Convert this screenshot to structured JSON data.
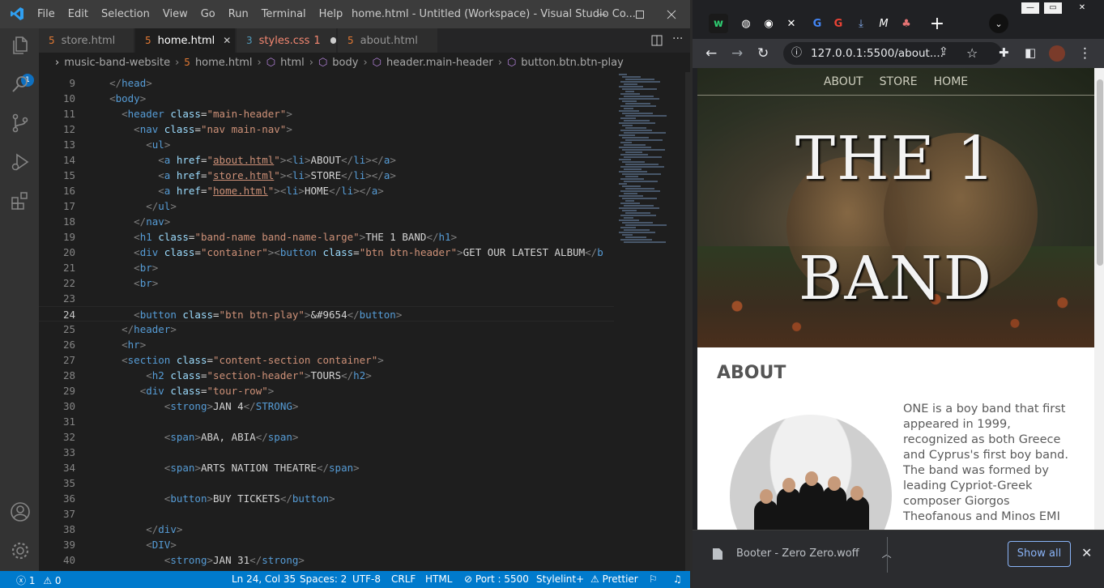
{
  "vscode": {
    "window_title": "home.html - Untitled (Workspace) - Visual Studio Co...",
    "menu": [
      "File",
      "Edit",
      "Selection",
      "View",
      "Go",
      "Run",
      "Terminal",
      "Help"
    ],
    "explorer_badge": "1",
    "tabs": [
      {
        "label": "store.html",
        "type": "html",
        "active": false
      },
      {
        "label": "home.html",
        "type": "html",
        "active": true
      },
      {
        "label": "styles.css",
        "type": "css",
        "active": false,
        "problems": "1",
        "modified": true
      },
      {
        "label": "about.html",
        "type": "html",
        "active": false
      }
    ],
    "breadcrumb": [
      "music-band-website",
      "home.html",
      "html",
      "body",
      "header.main-header",
      "button.btn.btn-play"
    ],
    "code_lines": [
      {
        "n": "9",
        "html": "  <span class='p'>&lt;/</span><span class='t'>head</span><span class='p'>&gt;</span>"
      },
      {
        "n": "10",
        "html": "  <span class='p'>&lt;</span><span class='t'>body</span><span class='p'>&gt;</span>"
      },
      {
        "n": "11",
        "html": "    <span class='p'>&lt;</span><span class='t'>header</span> <span class='a'>class</span>=<span class='s'>\"main-header\"</span><span class='p'>&gt;</span>"
      },
      {
        "n": "12",
        "html": "      <span class='p'>&lt;</span><span class='t'>nav</span> <span class='a'>class</span>=<span class='s'>\"nav main-nav\"</span><span class='p'>&gt;</span>"
      },
      {
        "n": "13",
        "html": "        <span class='p'>&lt;</span><span class='t'>ul</span><span class='p'>&gt;</span>"
      },
      {
        "n": "14",
        "html": "          <span class='p'>&lt;</span><span class='t'>a</span> <span class='a'>href</span>=<span class='s'>\"<span class='u'>about.html</span>\"</span><span class='p'>&gt;&lt;</span><span class='t'>li</span><span class='p'>&gt;</span>ABOUT<span class='p'>&lt;/</span><span class='t'>li</span><span class='p'>&gt;&lt;/</span><span class='t'>a</span><span class='p'>&gt;</span>"
      },
      {
        "n": "15",
        "html": "          <span class='p'>&lt;</span><span class='t'>a</span> <span class='a'>href</span>=<span class='s'>\"<span class='u'>store.html</span>\"</span><span class='p'>&gt;&lt;</span><span class='t'>li</span><span class='p'>&gt;</span>STORE<span class='p'>&lt;/</span><span class='t'>li</span><span class='p'>&gt;&lt;/</span><span class='t'>a</span><span class='p'>&gt;</span>"
      },
      {
        "n": "16",
        "html": "          <span class='p'>&lt;</span><span class='t'>a</span> <span class='a'>href</span>=<span class='s'>\"<span class='u'>home.html</span>\"</span><span class='p'>&gt;&lt;</span><span class='t'>li</span><span class='p'>&gt;</span>HOME<span class='p'>&lt;/</span><span class='t'>li</span><span class='p'>&gt;&lt;/</span><span class='t'>a</span><span class='p'>&gt;</span>"
      },
      {
        "n": "17",
        "html": "        <span class='p'>&lt;/</span><span class='t'>ul</span><span class='p'>&gt;</span>"
      },
      {
        "n": "18",
        "html": "      <span class='p'>&lt;/</span><span class='t'>nav</span><span class='p'>&gt;</span>"
      },
      {
        "n": "19",
        "html": "      <span class='p'>&lt;</span><span class='t'>h1</span> <span class='a'>class</span>=<span class='s'>\"band-name band-name-large\"</span><span class='p'>&gt;</span>THE 1 BAND<span class='p'>&lt;/</span><span class='t'>h1</span><span class='p'>&gt;</span>"
      },
      {
        "n": "20",
        "html": "      <span class='p'>&lt;</span><span class='t'>div</span> <span class='a'>class</span>=<span class='s'>\"container\"</span><span class='p'>&gt;&lt;</span><span class='t'>button</span> <span class='a'>class</span>=<span class='s'>\"btn btn-header\"</span><span class='p'>&gt;</span>GET OUR LATEST ALBUM<span class='p'>&lt;/</span><span class='t'>b</span>"
      },
      {
        "n": "21",
        "html": "      <span class='p'>&lt;</span><span class='t'>br</span><span class='p'>&gt;</span>"
      },
      {
        "n": "22",
        "html": "      <span class='p'>&lt;</span><span class='t'>br</span><span class='p'>&gt;</span>"
      },
      {
        "n": "23",
        "html": ""
      },
      {
        "n": "24",
        "html": "      <span class='p'>&lt;</span><span class='t'>button</span> <span class='a'>class</span>=<span class='s'>\"btn btn-play\"</span><span class='p'>&gt;</span>&amp;#9654<span class='p'>&lt;/</span><span class='t'>button</span><span class='p'>&gt;</span>"
      },
      {
        "n": "25",
        "html": "    <span class='p'>&lt;/</span><span class='t'>header</span><span class='p'>&gt;</span>"
      },
      {
        "n": "26",
        "html": "    <span class='p'>&lt;</span><span class='t'>hr</span><span class='p'>&gt;</span>"
      },
      {
        "n": "27",
        "html": "    <span class='p'>&lt;</span><span class='t'>section</span> <span class='a'>class</span>=<span class='s'>\"content-section container\"</span><span class='p'>&gt;</span>"
      },
      {
        "n": "28",
        "html": "        <span class='p'>&lt;</span><span class='t'>h2</span> <span class='a'>class</span>=<span class='s'>\"section-header\"</span><span class='p'>&gt;</span>TOURS<span class='p'>&lt;/</span><span class='t'>h2</span><span class='p'>&gt;</span>"
      },
      {
        "n": "29",
        "html": "       <span class='p'>&lt;</span><span class='t'>div</span> <span class='a'>class</span>=<span class='s'>\"tour-row\"</span><span class='p'>&gt;</span>"
      },
      {
        "n": "30",
        "html": "           <span class='p'>&lt;</span><span class='t'>strong</span><span class='p'>&gt;</span>JAN 4<span class='p'>&lt;/</span><span class='t'>STRONG</span><span class='p'>&gt;</span>"
      },
      {
        "n": "31",
        "html": ""
      },
      {
        "n": "32",
        "html": "           <span class='p'>&lt;</span><span class='t'>span</span><span class='p'>&gt;</span>ABA, ABIA<span class='p'>&lt;/</span><span class='t'>span</span><span class='p'>&gt;</span>"
      },
      {
        "n": "33",
        "html": ""
      },
      {
        "n": "34",
        "html": "           <span class='p'>&lt;</span><span class='t'>span</span><span class='p'>&gt;</span>ARTS NATION THEATRE<span class='p'>&lt;/</span><span class='t'>span</span><span class='p'>&gt;</span>"
      },
      {
        "n": "35",
        "html": ""
      },
      {
        "n": "36",
        "html": "           <span class='p'>&lt;</span><span class='t'>button</span><span class='p'>&gt;</span>BUY TICKETS<span class='p'>&lt;/</span><span class='t'>button</span><span class='p'>&gt;</span>"
      },
      {
        "n": "37",
        "html": ""
      },
      {
        "n": "38",
        "html": "        <span class='p'>&lt;/</span><span class='t'>div</span><span class='p'>&gt;</span>"
      },
      {
        "n": "39",
        "html": "        <span class='p'>&lt;</span><span class='t'>DIV</span><span class='p'>&gt;</span>"
      },
      {
        "n": "40",
        "html": "           <span class='p'>&lt;</span><span class='t'>strong</span><span class='p'>&gt;</span>JAN 31<span class='p'>&lt;/</span><span class='t'>strong</span><span class='p'>&gt;</span>"
      }
    ],
    "status": {
      "errors": "1",
      "warnings": "0",
      "position": "Ln 24, Col 35",
      "spaces": "Spaces: 2",
      "encoding": "UTF-8",
      "eol": "CRLF",
      "language": "HTML",
      "port": "Port : 5500",
      "stylelint": "Stylelint+",
      "prettier": "Prettier"
    }
  },
  "chrome": {
    "url": "127.0.0.1:5500/about....",
    "page": {
      "nav": [
        "ABOUT",
        "STORE",
        "HOME"
      ],
      "band_name_line1": "THE 1",
      "band_name_line2": "BAND",
      "about_heading": "ABOUT",
      "about_text": "ONE is a boy band that first appeared in 1999, recognized as both Greece and Cyprus's first boy band. The band was formed by leading Cypriot-Greek composer Giorgos Theofanous and Minos EMI"
    },
    "download": {
      "file": "Booter - Zero Zero.woff",
      "show_all": "Show all"
    }
  }
}
